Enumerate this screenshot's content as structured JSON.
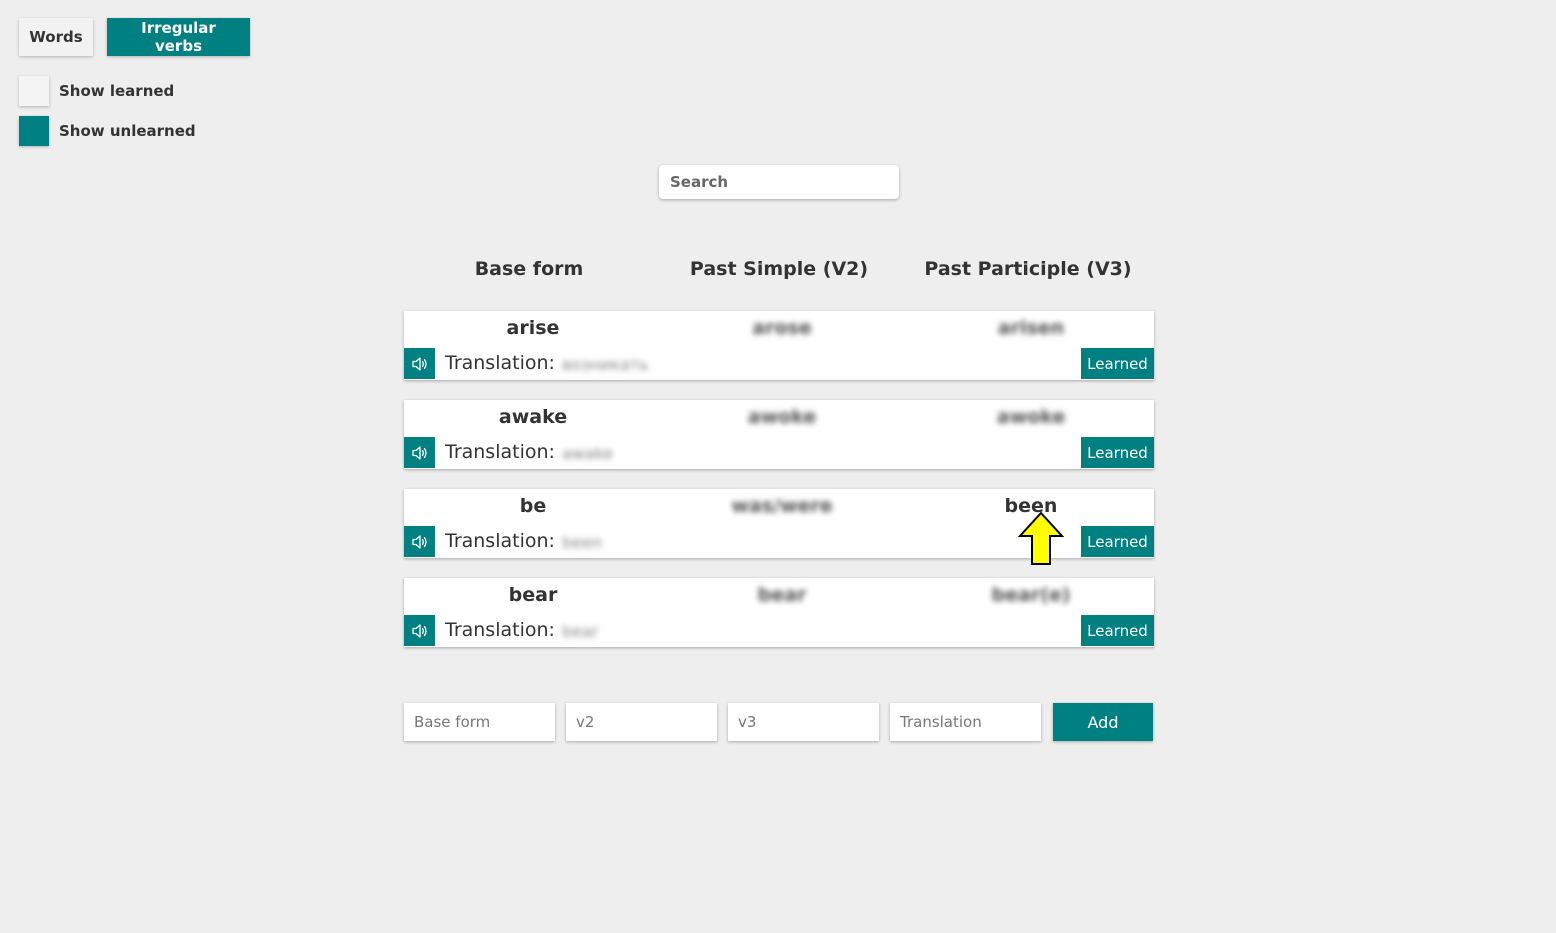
{
  "tabs": {
    "words": "Words",
    "irregular_verbs": "Irregular verbs"
  },
  "filters": {
    "show_learned": "Show learned",
    "show_unlearned": "Show unlearned",
    "show_learned_checked": false,
    "show_unlearned_checked": true
  },
  "search": {
    "placeholder": "Search",
    "value": ""
  },
  "columns": {
    "base": "Base form",
    "v2": "Past Simple (V2)",
    "v3": "Past Participle (V3)"
  },
  "verbs": [
    {
      "base": "arise",
      "v2": "arose",
      "v3": "arisen",
      "translation_label": "Translation:",
      "translation": "возникать",
      "learned_label": "Learned"
    },
    {
      "base": "awake",
      "v2": "awoke",
      "v3": "awoke",
      "translation_label": "Translation:",
      "translation": "awake",
      "learned_label": "Learned"
    },
    {
      "base": "be",
      "v2": "was/were",
      "v3": "been",
      "translation_label": "Translation:",
      "translation": "been",
      "learned_label": "Learned"
    },
    {
      "base": "bear",
      "v2": "bear",
      "v3": "bear(e)",
      "translation_label": "Translation:",
      "translation": "bear",
      "learned_label": "Learned"
    }
  ],
  "add_form": {
    "base_placeholder": "Base form",
    "v2_placeholder": "v2",
    "v3_placeholder": "v3",
    "translation_placeholder": "Translation",
    "add_label": "Add"
  },
  "colors": {
    "accent": "#008080",
    "background": "#eeeeee",
    "cursor": "#ffff00"
  },
  "icons": {
    "sound": "speaker-icon",
    "cursor": "arrow-up-icon"
  }
}
